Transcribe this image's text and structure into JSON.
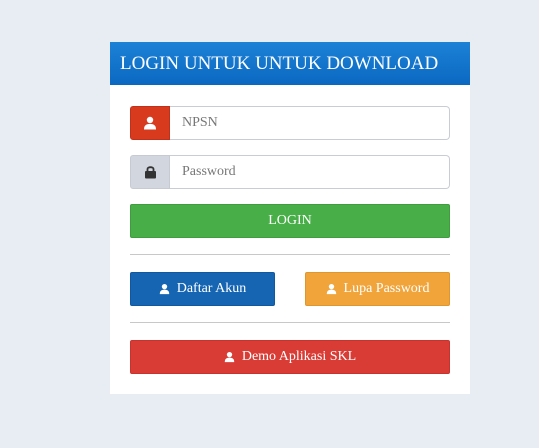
{
  "panel": {
    "title": "LOGIN UNTUK UNTUK DOWNLOAD"
  },
  "form": {
    "npsn": {
      "placeholder": "NPSN",
      "icon": "user-icon",
      "value": ""
    },
    "password": {
      "placeholder": "Password",
      "icon": "lock-icon",
      "value": ""
    },
    "login_label": "LOGIN"
  },
  "actions": {
    "daftar_label": "Daftar Akun",
    "lupa_label": "Lupa Password",
    "demo_label": "Demo Aplikasi SKL"
  },
  "colors": {
    "header": "#0b68c2",
    "login": "#48ae48",
    "daftar": "#1565b3",
    "lupa": "#f0a43a",
    "demo": "#d93c35",
    "npsn_addon": "#d83a1e"
  }
}
